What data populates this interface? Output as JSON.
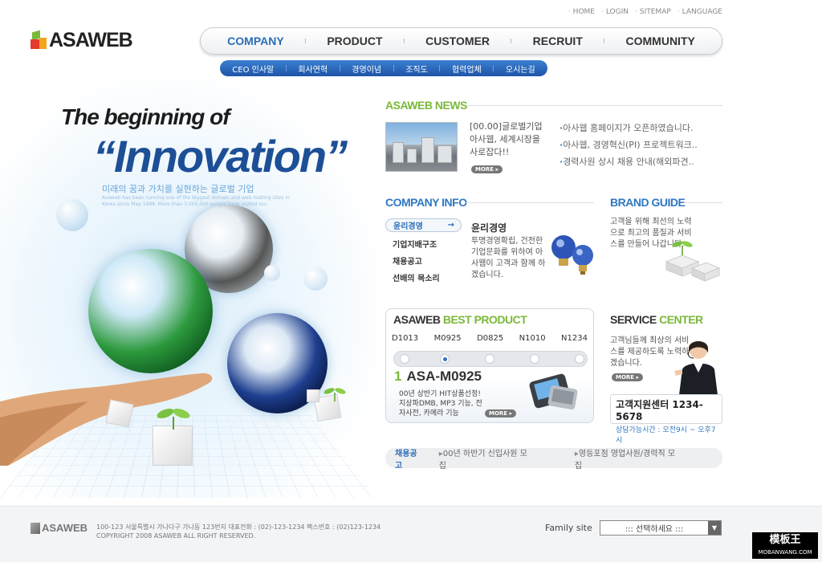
{
  "top_links": [
    "HOME",
    "LOGIN",
    "SITEMAP",
    "LANGUAGE"
  ],
  "logo": {
    "text": "ASAWEB"
  },
  "main_nav": {
    "items": [
      "COMPANY",
      "PRODUCT",
      "CUSTOMER",
      "RECRUIT",
      "COMMUNITY"
    ],
    "active": "COMPANY"
  },
  "sub_nav": [
    "CEO 인사말",
    "회사연혁",
    "경영이념",
    "조직도",
    "협력업체",
    "오시는길"
  ],
  "hero": {
    "title_line1": "The beginning of",
    "title_line2": "“Innovation”",
    "subtitle": "미래의 꿈과 가치를 실현하는 글로벌 기업",
    "fine_print": "Asaweb has been running one of the biggest domain and web hosting sites in Korea since May 1998. More than 3,000,000 people have visited our."
  },
  "news": {
    "title": "ASAWEB NEWS",
    "feature": "[00.00]글로벌기업 아사웹, 세계시장을 사로잡다!!",
    "more_label": "MORE",
    "items": [
      "아사웹 홈페이지가 오픈하였습니다.",
      "아사웹, 경영혁신(PI) 프로젝트워크..",
      "경력사원 상시 채용 안내(해외파견.."
    ]
  },
  "company_info": {
    "title": "COMPANY INFO",
    "menu": [
      "윤리경영",
      "기업지배구조",
      "채용공고",
      "선배의 목소리"
    ],
    "active": "윤리경영",
    "heading": "윤리경영",
    "text": "투명경영확립, 건전한 기업문화를 위하여 아사웹이 고객과 함께 하겠습니다."
  },
  "brand_guide": {
    "title": "BRAND GUIDE",
    "text": "고객을 위해 최선의 노력으로 최고의 품질과 서비스를 만들어 나갑니다."
  },
  "best_product": {
    "title_part1": "ASAWEB",
    "title_part2": "BEST PRODUCT",
    "codes": [
      "D1013",
      "M0925",
      "D0825",
      "N1010",
      "N1234"
    ],
    "active_index": 1,
    "rank": "1",
    "model": "ASA-M0925",
    "desc": "00년 상반기 HIT상품선정! 지상파DMB, MP3 기능, 전자사전, 카메라 기능",
    "more_label": "MORE"
  },
  "service_center": {
    "title_part1": "SERVICE",
    "title_part2": "CENTER",
    "text": "고객님들께 최상의 서비스를 제공하도록 노력하겠습니다.",
    "more_label": "MORE",
    "phone": "고객지원센터 1234-5678",
    "hours": "상담가능시간 : 오전9시 ~ 오후7시"
  },
  "recruit_bar": {
    "label": "채용공고",
    "items": [
      "00년 하반기 신입사원 모집",
      "영등포점 영업사원/경력직 모집"
    ]
  },
  "footer": {
    "logo_text": "ASAWEB",
    "address": "100-123 서울특별시 가나다구 가나동 123번지 대표전화 : (02)-123-1234 팩스번호 : (02)123-1234",
    "copyright": "COPYRIGHT 2008 ASAWEB  ALL RIGHT RESERVED.",
    "family_label": "Family site",
    "family_select": "::: 선택하세요 :::"
  },
  "watermark": {
    "line1": "模板王",
    "line2": "MOBANWANG.COM"
  },
  "colors": {
    "brand_blue": "#3077c0",
    "accent_green": "#7ab83a",
    "nav_active": "#2a6db6",
    "subnav_bg": "#1f55a8"
  }
}
